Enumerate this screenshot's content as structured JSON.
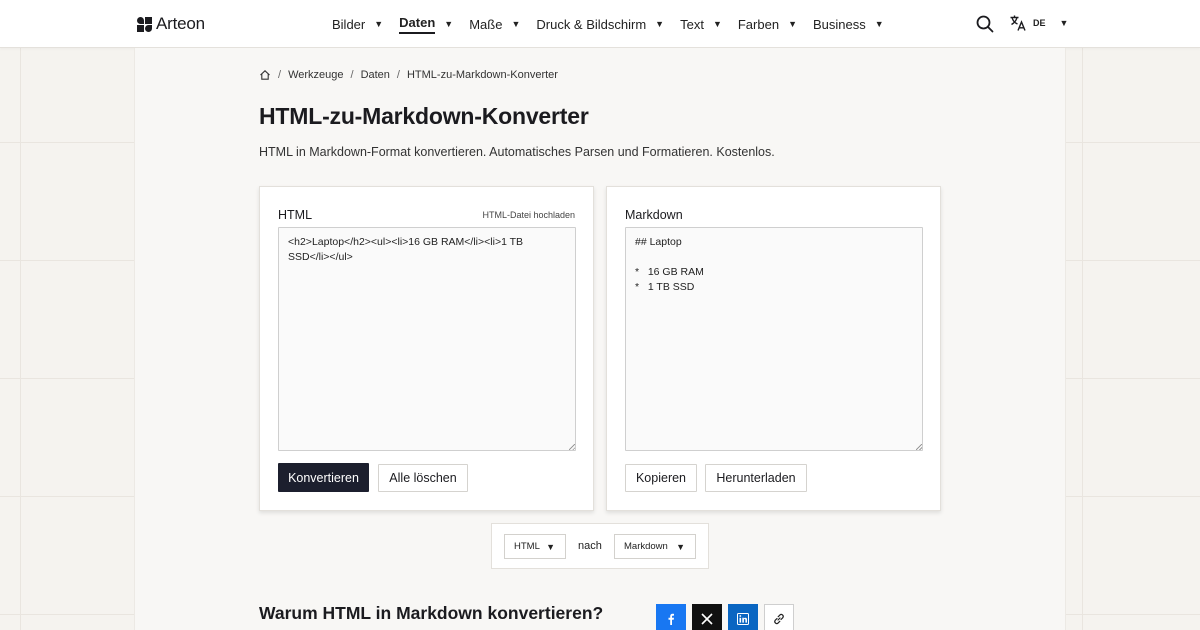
{
  "header": {
    "logo_text": "Arteon",
    "nav": [
      {
        "label": "Bilder",
        "active": false
      },
      {
        "label": "Daten",
        "active": true
      },
      {
        "label": "Maße",
        "active": false
      },
      {
        "label": "Druck & Bildschirm",
        "active": false
      },
      {
        "label": "Text",
        "active": false
      },
      {
        "label": "Farben",
        "active": false
      },
      {
        "label": "Business",
        "active": false
      }
    ],
    "language": "DE"
  },
  "breadcrumb": {
    "items": [
      "Werkzeuge",
      "Daten"
    ],
    "current": "HTML-zu-Markdown-Konverter"
  },
  "page": {
    "title": "HTML-zu-Markdown-Konverter",
    "subtitle": "HTML in Markdown-Format konvertieren. Automatisches Parsen und Formatieren. Kostenlos."
  },
  "input_card": {
    "label": "HTML",
    "upload_link": "HTML-Datei hochladen",
    "value": "<h2>Laptop</h2><ul><li>16 GB RAM</li><li>1 TB SSD</li></ul>",
    "convert_button": "Konvertieren",
    "clear_button": "Alle löschen"
  },
  "output_card": {
    "label": "Markdown",
    "value": "## Laptop\n\n*   16 GB RAM\n*   1 TB SSD",
    "copy_button": "Kopieren",
    "download_button": "Herunterladen"
  },
  "format_selector": {
    "from": "HTML",
    "connector": "nach",
    "to": "Markdown"
  },
  "section": {
    "heading": "Warum HTML in Markdown konvertieren?"
  },
  "share": {
    "icons": [
      "facebook-icon",
      "x-icon",
      "linkedin-icon",
      "link-icon"
    ],
    "colors": {
      "facebook": "#1877f2",
      "x": "#111111",
      "linkedin": "#0a66c2"
    }
  },
  "colors": {
    "primary_button": "#1c1f2e",
    "page_background": "#f5f3ef"
  }
}
